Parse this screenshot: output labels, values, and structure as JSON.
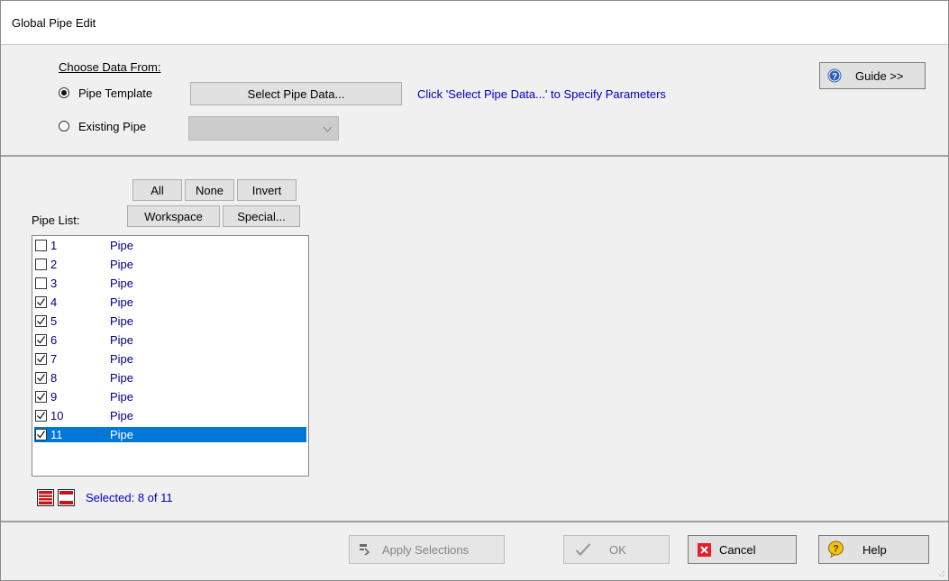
{
  "window": {
    "title": "Global Pipe Edit"
  },
  "source": {
    "heading": "Choose Data From:",
    "options": [
      {
        "label": "Pipe Template",
        "checked": true
      },
      {
        "label": "Existing Pipe",
        "checked": false
      }
    ],
    "select_button": "Select Pipe Data...",
    "hint": "Click 'Select Pipe Data...' to Specify Parameters",
    "existing_pipe_value": ""
  },
  "guide_button": "Guide >>",
  "filter_buttons": {
    "all": "All",
    "none": "None",
    "invert": "Invert",
    "workspace": "Workspace",
    "special": "Special..."
  },
  "pipe_list": {
    "label": "Pipe List:",
    "items": [
      {
        "id": "1",
        "name": "Pipe",
        "checked": false,
        "selected": false
      },
      {
        "id": "2",
        "name": "Pipe",
        "checked": false,
        "selected": false
      },
      {
        "id": "3",
        "name": "Pipe",
        "checked": false,
        "selected": false
      },
      {
        "id": "4",
        "name": "Pipe",
        "checked": true,
        "selected": false
      },
      {
        "id": "5",
        "name": "Pipe",
        "checked": true,
        "selected": false
      },
      {
        "id": "6",
        "name": "Pipe",
        "checked": true,
        "selected": false
      },
      {
        "id": "7",
        "name": "Pipe",
        "checked": true,
        "selected": false
      },
      {
        "id": "8",
        "name": "Pipe",
        "checked": true,
        "selected": false
      },
      {
        "id": "9",
        "name": "Pipe",
        "checked": true,
        "selected": false
      },
      {
        "id": "10",
        "name": "Pipe",
        "checked": true,
        "selected": false
      },
      {
        "id": "11",
        "name": "Pipe",
        "checked": true,
        "selected": true
      }
    ],
    "selected_text": "Selected: 8 of 11"
  },
  "footer": {
    "apply": "Apply Selections",
    "ok": "OK",
    "cancel": "Cancel",
    "help": "Help"
  },
  "colors": {
    "accent": "#0078d7",
    "link": "#0000c0",
    "list_text": "#00007f",
    "cancel_red": "#e0202a"
  }
}
